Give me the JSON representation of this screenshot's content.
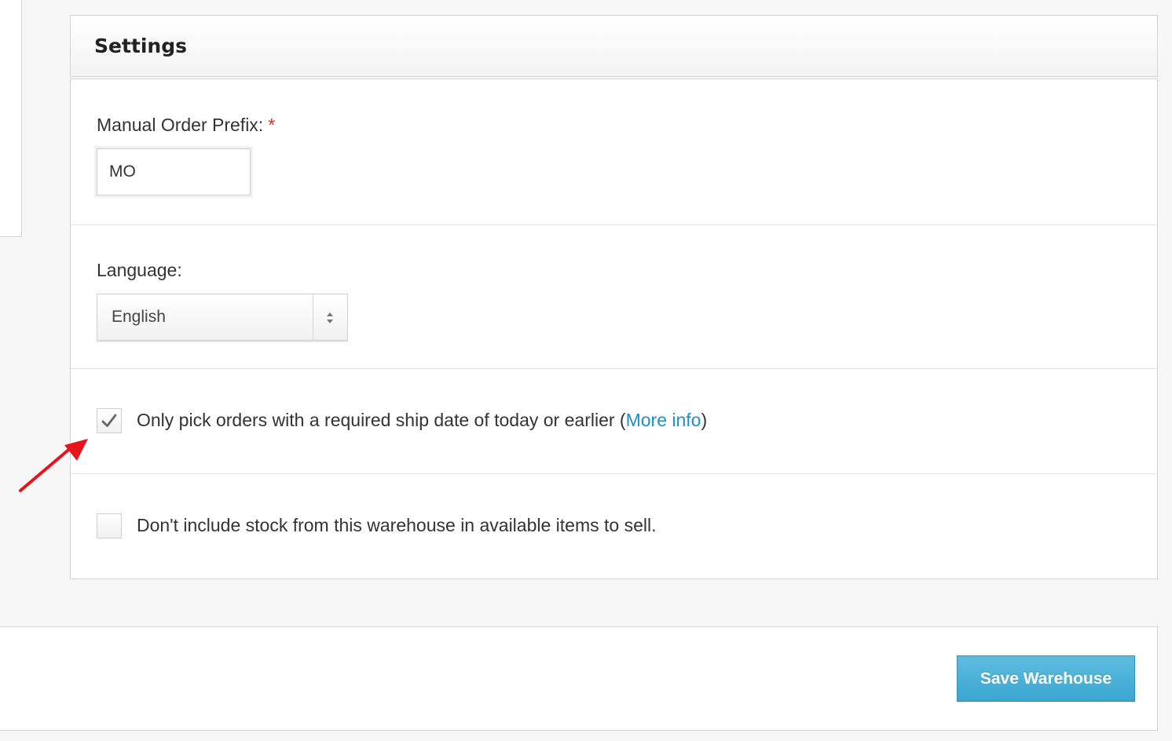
{
  "settings": {
    "title": "Settings"
  },
  "manual_order_prefix": {
    "label": "Manual Order Prefix:",
    "required_mark": "*",
    "value": "MO"
  },
  "language": {
    "label": "Language:",
    "selected": "English"
  },
  "ship_date_option": {
    "checked": true,
    "label_before": "Only pick orders with a required ship date of today or earlier (",
    "link_text": "More info",
    "label_after": ")"
  },
  "stock_option": {
    "checked": false,
    "label": "Don't include stock from this warehouse in available items to sell."
  },
  "footer": {
    "save_label": "Save Warehouse"
  },
  "colors": {
    "link": "#1a8fc9",
    "primary_button": "#3aa6d0",
    "required": "#c0392b",
    "annotation_arrow": "#e8141c"
  },
  "icons": {
    "checkmark": "check-icon",
    "select_arrows": "select-arrows-icon",
    "annotation": "red-arrow-icon"
  }
}
